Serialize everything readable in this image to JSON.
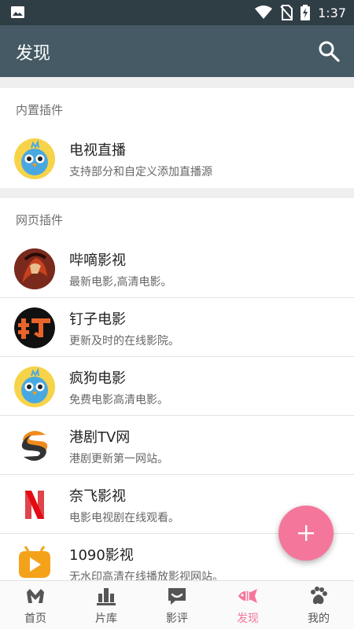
{
  "statusbar": {
    "time": "1:37"
  },
  "appbar": {
    "title": "发现"
  },
  "sections": [
    {
      "header": "内置插件",
      "items": [
        {
          "name": "电视直播",
          "desc": "支持部分和自定义添加直播源",
          "icon": "bird-icon"
        }
      ]
    },
    {
      "header": "网页插件",
      "items": [
        {
          "name": "哔嘀影视",
          "desc": "最新电影,高清电影。",
          "icon": "warrior-avatar-icon"
        },
        {
          "name": "钉子电影",
          "desc": "更新及时的在线影院。",
          "icon": "ding-logo-icon"
        },
        {
          "name": "疯狗电影",
          "desc": "免费电影高清电影。",
          "icon": "bird-icon"
        },
        {
          "name": "港剧TV网",
          "desc": "港剧更新第一网站。",
          "icon": "s-logo-icon"
        },
        {
          "name": "奈飞影视",
          "desc": "电影电视剧在线观看。",
          "icon": "netflix-n-icon"
        },
        {
          "name": "1090影视",
          "desc": "无水印高清在线播放影视网站。",
          "icon": "play-logo-icon"
        }
      ]
    }
  ],
  "bottom_nav": [
    {
      "label": "首页",
      "icon": "home-m-icon",
      "active": false
    },
    {
      "label": "片库",
      "icon": "library-icon",
      "active": false
    },
    {
      "label": "影评",
      "icon": "review-icon",
      "active": false
    },
    {
      "label": "发现",
      "icon": "fish-discover-icon",
      "active": true
    },
    {
      "label": "我的",
      "icon": "paw-icon",
      "active": false
    }
  ],
  "colors": {
    "appbar": "#455a64",
    "statusbar": "#2f3d45",
    "accent": "#f4769a"
  }
}
